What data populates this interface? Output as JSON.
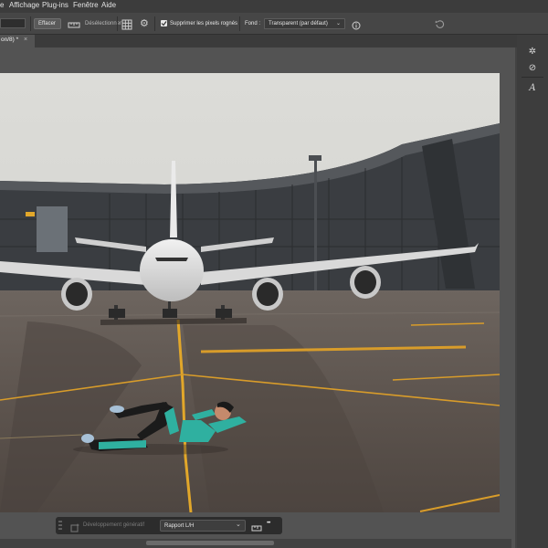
{
  "menu": {
    "items": [
      "e",
      "Affichage",
      "Plug-ins",
      "Fenêtre",
      "Aide"
    ]
  },
  "options_bar": {
    "clear_label": "Effacer",
    "deselect_label": "Désélectionner",
    "delete_cropped_label": "Supprimer les pixels rognés",
    "delete_cropped_checked": true,
    "fill_label": "Fond :",
    "fill_value": "Transparent (par défaut)"
  },
  "tab": {
    "title": "on/8) *",
    "close_glyph": "×"
  },
  "taskbar": {
    "generative_expand_label": "Développement génératif",
    "ratio_value": "Rapport L/H",
    "more_glyph": "•••"
  },
  "icons": [
    "straighten-icon",
    "grid-icon",
    "gear-icon",
    "info-icon",
    "reset-icon",
    "history-brush-icon",
    "brush-icon",
    "character-icon",
    "grip-icon",
    "generative-icon",
    "chevron-down-icon",
    "swap-icon",
    "more-icon"
  ],
  "colors": {
    "ui_dark": "#3c3c3c",
    "ui_mid": "#535353",
    "sky": "#d9d9d5",
    "tarmac": "#5f5650",
    "taxi_line": "#e2a72a",
    "outfit": "#2fb0a0"
  }
}
